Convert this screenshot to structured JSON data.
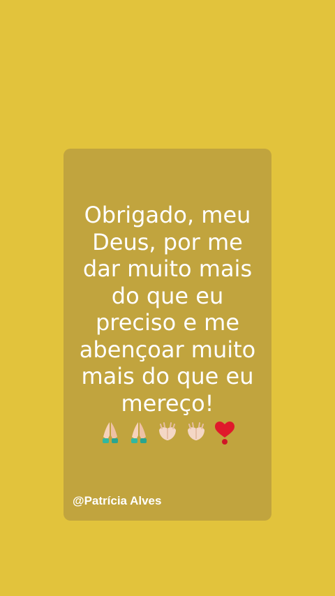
{
  "background_color": "#e2c33c",
  "card": {
    "background_color": "#c1a43e",
    "quote": "Obrigado, meu Deus, por me dar muito mais do que eu preciso e me abençoar muito mais do que eu mereço!",
    "emojis": [
      "folded-hands-icon",
      "folded-hands-icon",
      "clapping-hands-icon",
      "clapping-hands-icon",
      "red-heart-exclamation-icon"
    ],
    "author": "@Patrícia Alves"
  }
}
